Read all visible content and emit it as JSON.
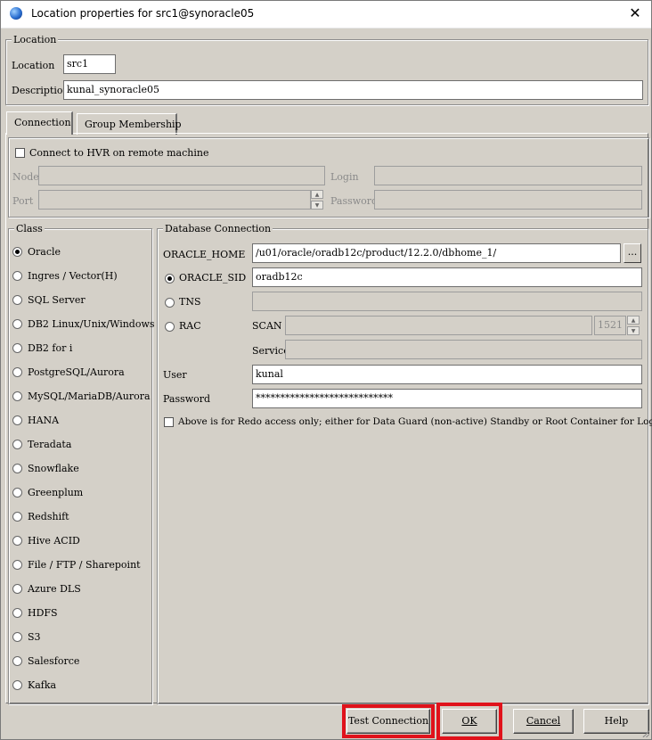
{
  "window": {
    "title": "Location properties for src1@synoracle05",
    "close_glyph": "✕"
  },
  "location_group": {
    "label": "Location",
    "location_label": "Location",
    "location_value": "src1",
    "description_label": "Description",
    "description_value": "kunal_synoracle05"
  },
  "tabs": [
    {
      "label": "Connection",
      "active": true
    },
    {
      "label": "Group Membership",
      "active": false
    }
  ],
  "remote": {
    "checkbox_label": "Connect to HVR on remote machine",
    "checked": false,
    "node_label": "Node",
    "port_label": "Port",
    "login_label": "Login",
    "password_label": "Password",
    "node_value": "",
    "port_value": "",
    "login_value": "",
    "password_value": ""
  },
  "class_group": {
    "label": "Class",
    "selected": "Oracle",
    "items": [
      "Oracle",
      "Ingres / Vector(H)",
      "SQL Server",
      "DB2 Linux/Unix/Windows",
      "DB2 for i",
      "PostgreSQL/Aurora",
      "MySQL/MariaDB/Aurora",
      "HANA",
      "Teradata",
      "Snowflake",
      "Greenplum",
      "Redshift",
      "Hive ACID",
      "File / FTP / Sharepoint",
      "Azure DLS",
      "HDFS",
      "S3",
      "Salesforce",
      "Kafka"
    ]
  },
  "db_group": {
    "label": "Database Connection",
    "oracle_home_label": "ORACLE_HOME",
    "oracle_home_value": "/u01/oracle/oradb12c/product/12.2.0/dbhome_1/",
    "browse_label": "...",
    "mode_selected": "ORACLE_SID",
    "oracle_sid_label": "ORACLE_SID",
    "oracle_sid_value": "oradb12c",
    "tns_label": "TNS",
    "tns_value": "",
    "rac_label": "RAC",
    "scan_label": "SCAN",
    "scan_value": "",
    "scan_port": "1521",
    "service_label": "Service",
    "service_value": "",
    "user_label": "User",
    "user_value": "kunal",
    "password_label": "Password",
    "password_value": "****************************",
    "redo_checkbox_label": "Above is for Redo access only; either for Data Guard (non-active) Standby or Root Container for LogMiner",
    "redo_checked": false
  },
  "buttons": {
    "test_connection": "Test Connection",
    "ok": "OK",
    "cancel": "Cancel",
    "help": "Help"
  },
  "colors": {
    "dialog_bg": "#d4d0c8",
    "highlight": "#e0121b"
  }
}
